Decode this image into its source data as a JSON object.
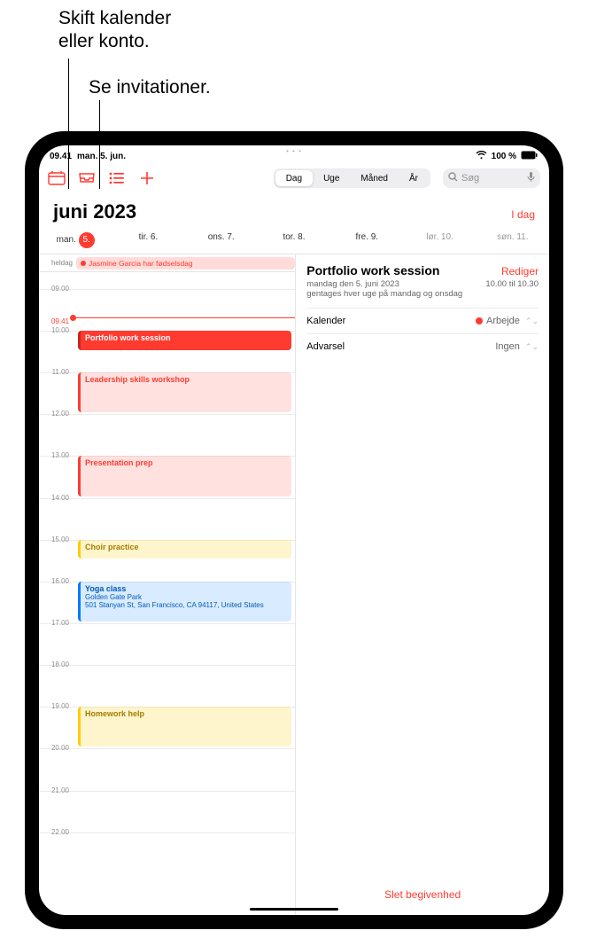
{
  "callouts": {
    "switch_calendar": "Skift kalender\neller konto.",
    "see_invitations": "Se invitationer."
  },
  "statusbar": {
    "time": "09.41",
    "date": "man. 5. jun.",
    "battery_text": "100 %"
  },
  "toolbar": {
    "segments": {
      "day": "Dag",
      "week": "Uge",
      "month": "Måned",
      "year": "År"
    },
    "search_placeholder": "Søg"
  },
  "header": {
    "month_year": "juni 2023",
    "today": "I dag"
  },
  "days": [
    {
      "label": "man.",
      "num": "5.",
      "today": true
    },
    {
      "label": "tir.",
      "num": "6."
    },
    {
      "label": "ons.",
      "num": "7."
    },
    {
      "label": "tor.",
      "num": "8."
    },
    {
      "label": "fre.",
      "num": "9."
    },
    {
      "label": "lør.",
      "num": "10.",
      "wknd": true
    },
    {
      "label": "søn.",
      "num": "11.",
      "wknd": true
    }
  ],
  "allday": {
    "label": "heldag",
    "event": "Jasmine Garcia har fødselsdag"
  },
  "hours": [
    "09.00",
    "10.00",
    "11.00",
    "12.00",
    "13.00",
    "14.00",
    "15.00",
    "16.00",
    "17.00",
    "18.00",
    "19.00",
    "20.00",
    "21.00",
    "22.00"
  ],
  "now_label": "09.41",
  "events": [
    {
      "title": "Portfolio work session",
      "cls": "ev-red-solid",
      "start": "10.00",
      "end": "10.30"
    },
    {
      "title": "Leadership skills workshop",
      "cls": "ev-red-light",
      "start": "11.00",
      "end": "12.00"
    },
    {
      "title": "Presentation prep",
      "cls": "ev-red-light",
      "start": "13.00",
      "end": "14.00"
    },
    {
      "title": "Choir practice",
      "cls": "ev-yellow",
      "start": "15.00",
      "end": "15.30"
    },
    {
      "title": "Yoga class",
      "sub1": "Golden Gate Park",
      "sub2": "501 Stanyan St, San Francisco, CA 94117, United States",
      "cls": "ev-blue",
      "start": "16.00",
      "end": "17.00"
    },
    {
      "title": "Homework help",
      "cls": "ev-yellow",
      "start": "19.00",
      "end": "20.00"
    }
  ],
  "detail": {
    "title": "Portfolio work session",
    "edit": "Rediger",
    "date": "mandag den 5. juni 2023",
    "time": "10.00 til 10.30",
    "repeat": "gentages hver uge på mandag og onsdag",
    "calendar_label": "Kalender",
    "calendar_value": "Arbejde",
    "alert_label": "Advarsel",
    "alert_value": "Ingen",
    "delete": "Slet begivenhed"
  }
}
